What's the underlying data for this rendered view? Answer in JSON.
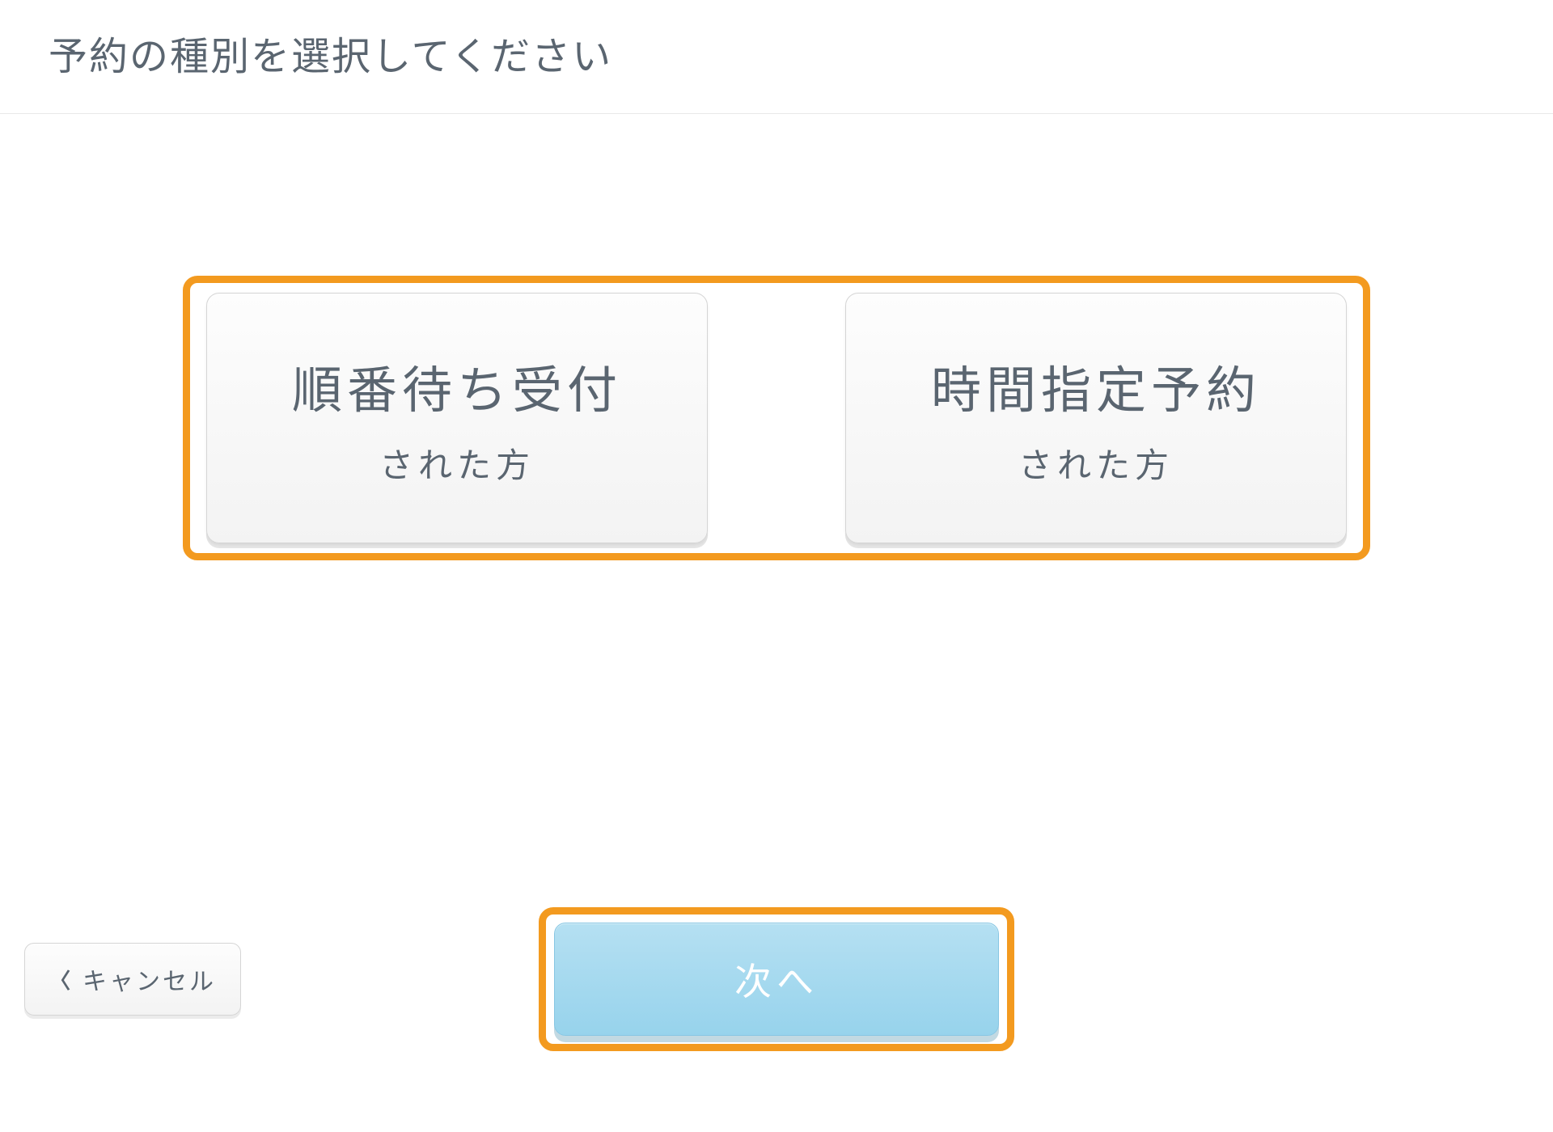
{
  "header": {
    "title": "予約の種別を選択してください"
  },
  "options": [
    {
      "title": "順番待ち受付",
      "subtitle": "された方"
    },
    {
      "title": "時間指定予約",
      "subtitle": "された方"
    }
  ],
  "footer": {
    "cancel_label": "キャンセル",
    "next_label": "次へ"
  },
  "colors": {
    "highlight": "#f39a1f",
    "primary_button": "#97d3ec",
    "text": "#5a6570"
  }
}
